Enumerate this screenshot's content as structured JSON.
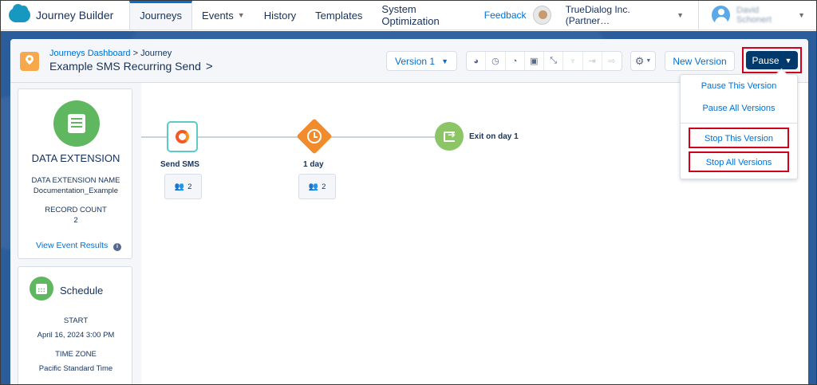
{
  "topnav": {
    "brand": "Journey Builder",
    "tabs": [
      {
        "label": "Journeys"
      },
      {
        "label": "Events"
      },
      {
        "label": "History"
      },
      {
        "label": "Templates"
      },
      {
        "label": "System Optimization"
      }
    ],
    "feedback": "Feedback",
    "org": "TrueDialog Inc. (Partner…",
    "user_name": "David Schonert"
  },
  "header": {
    "breadcrumb_link": "Journeys Dashboard",
    "breadcrumb_sep": ">",
    "breadcrumb_current": "Journey",
    "journey_title": "Example SMS Recurring Send",
    "version_label": "Version 1",
    "new_version_label": "New Version",
    "pause_label": "Pause"
  },
  "entry_panel": {
    "title": "DATA EXTENSION",
    "name_label": "DATA EXTENSION NAME",
    "name_value": "Documentation_Example",
    "count_label": "RECORD COUNT",
    "count_value": "2",
    "link": "View Event Results"
  },
  "schedule_panel": {
    "title": "Schedule",
    "start_label": "START",
    "start_value": "April 16, 2024 3:00 PM",
    "tz_label": "TIME ZONE",
    "tz_value": "Pacific Standard Time"
  },
  "canvas": {
    "nodes": [
      {
        "label": "Send SMS",
        "count": "2"
      },
      {
        "label": "1 day",
        "count": "2"
      },
      {
        "label": "Exit on day 1"
      }
    ]
  },
  "pause_menu": {
    "items": [
      {
        "label": "Pause This Version"
      },
      {
        "label": "Pause All Versions"
      },
      {
        "label": "Stop This Version"
      },
      {
        "label": "Stop All Versions"
      }
    ]
  },
  "colors": {
    "accent": "#0070d2",
    "pause_button": "#00396b",
    "highlight": "#d0021b",
    "background_band": "#2b5d9c"
  }
}
